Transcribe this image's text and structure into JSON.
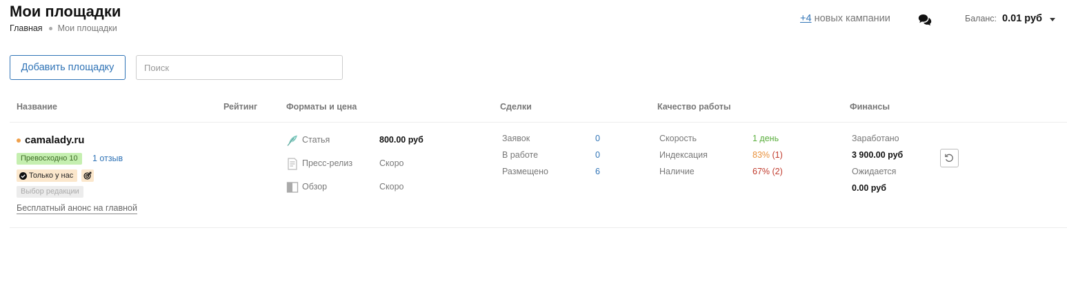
{
  "header": {
    "title": "Мои площадки",
    "breadcrumb": {
      "home": "Главная",
      "current": "Мои площадки"
    },
    "campaigns": {
      "count": "+4",
      "text": "новых кампании"
    },
    "balance": {
      "label": "Баланс:",
      "amount": "0.01 руб"
    }
  },
  "toolbar": {
    "add_label": "Добавить площадку",
    "search_placeholder": "Поиск"
  },
  "table": {
    "columns": {
      "name": "Название",
      "rating": "Рейтинг",
      "formats": "Форматы и цена",
      "deals": "Сделки",
      "quality": "Качество работы",
      "finance": "Финансы"
    },
    "rows": [
      {
        "site": "camalady.ru",
        "rating_badge": "Превосходно 10",
        "reviews": "1 отзыв",
        "exclusive_badge": "Только у нас",
        "editor_badge": "Выбор редакции",
        "free_promo": "Бесплатный анонс на главной",
        "formats": [
          {
            "icon": "feather-icon",
            "label": "Статья",
            "price": "800.00 руб"
          },
          {
            "icon": "press-release-icon",
            "label": "Пресс-релиз",
            "price": "Скоро"
          },
          {
            "icon": "review-icon",
            "label": "Обзор",
            "price": "Скоро"
          }
        ],
        "deals": [
          {
            "label": "Заявок",
            "value": "0"
          },
          {
            "label": "В работе",
            "value": "0"
          },
          {
            "label": "Размещено",
            "value": "6"
          }
        ],
        "quality": [
          {
            "label": "Скорость",
            "value": "1 день"
          },
          {
            "label": "Индексация",
            "value": "83%",
            "extra": "(1)"
          },
          {
            "label": "Наличие",
            "value": "67%",
            "extra": "(2)"
          }
        ],
        "finance": {
          "earned_label": "Заработано",
          "earned": "3 900.00 руб",
          "expected_label": "Ожидается",
          "expected": "0.00 руб"
        }
      }
    ]
  },
  "colors": {
    "accent": "#2f73b6",
    "rating_bg": "#c5efb0",
    "exclusive_bg": "#fbe7cc",
    "speed": "#5aae3d",
    "indexation": "#e8903a",
    "availability": "#c0392b",
    "status_dot": "#f0a04b"
  }
}
